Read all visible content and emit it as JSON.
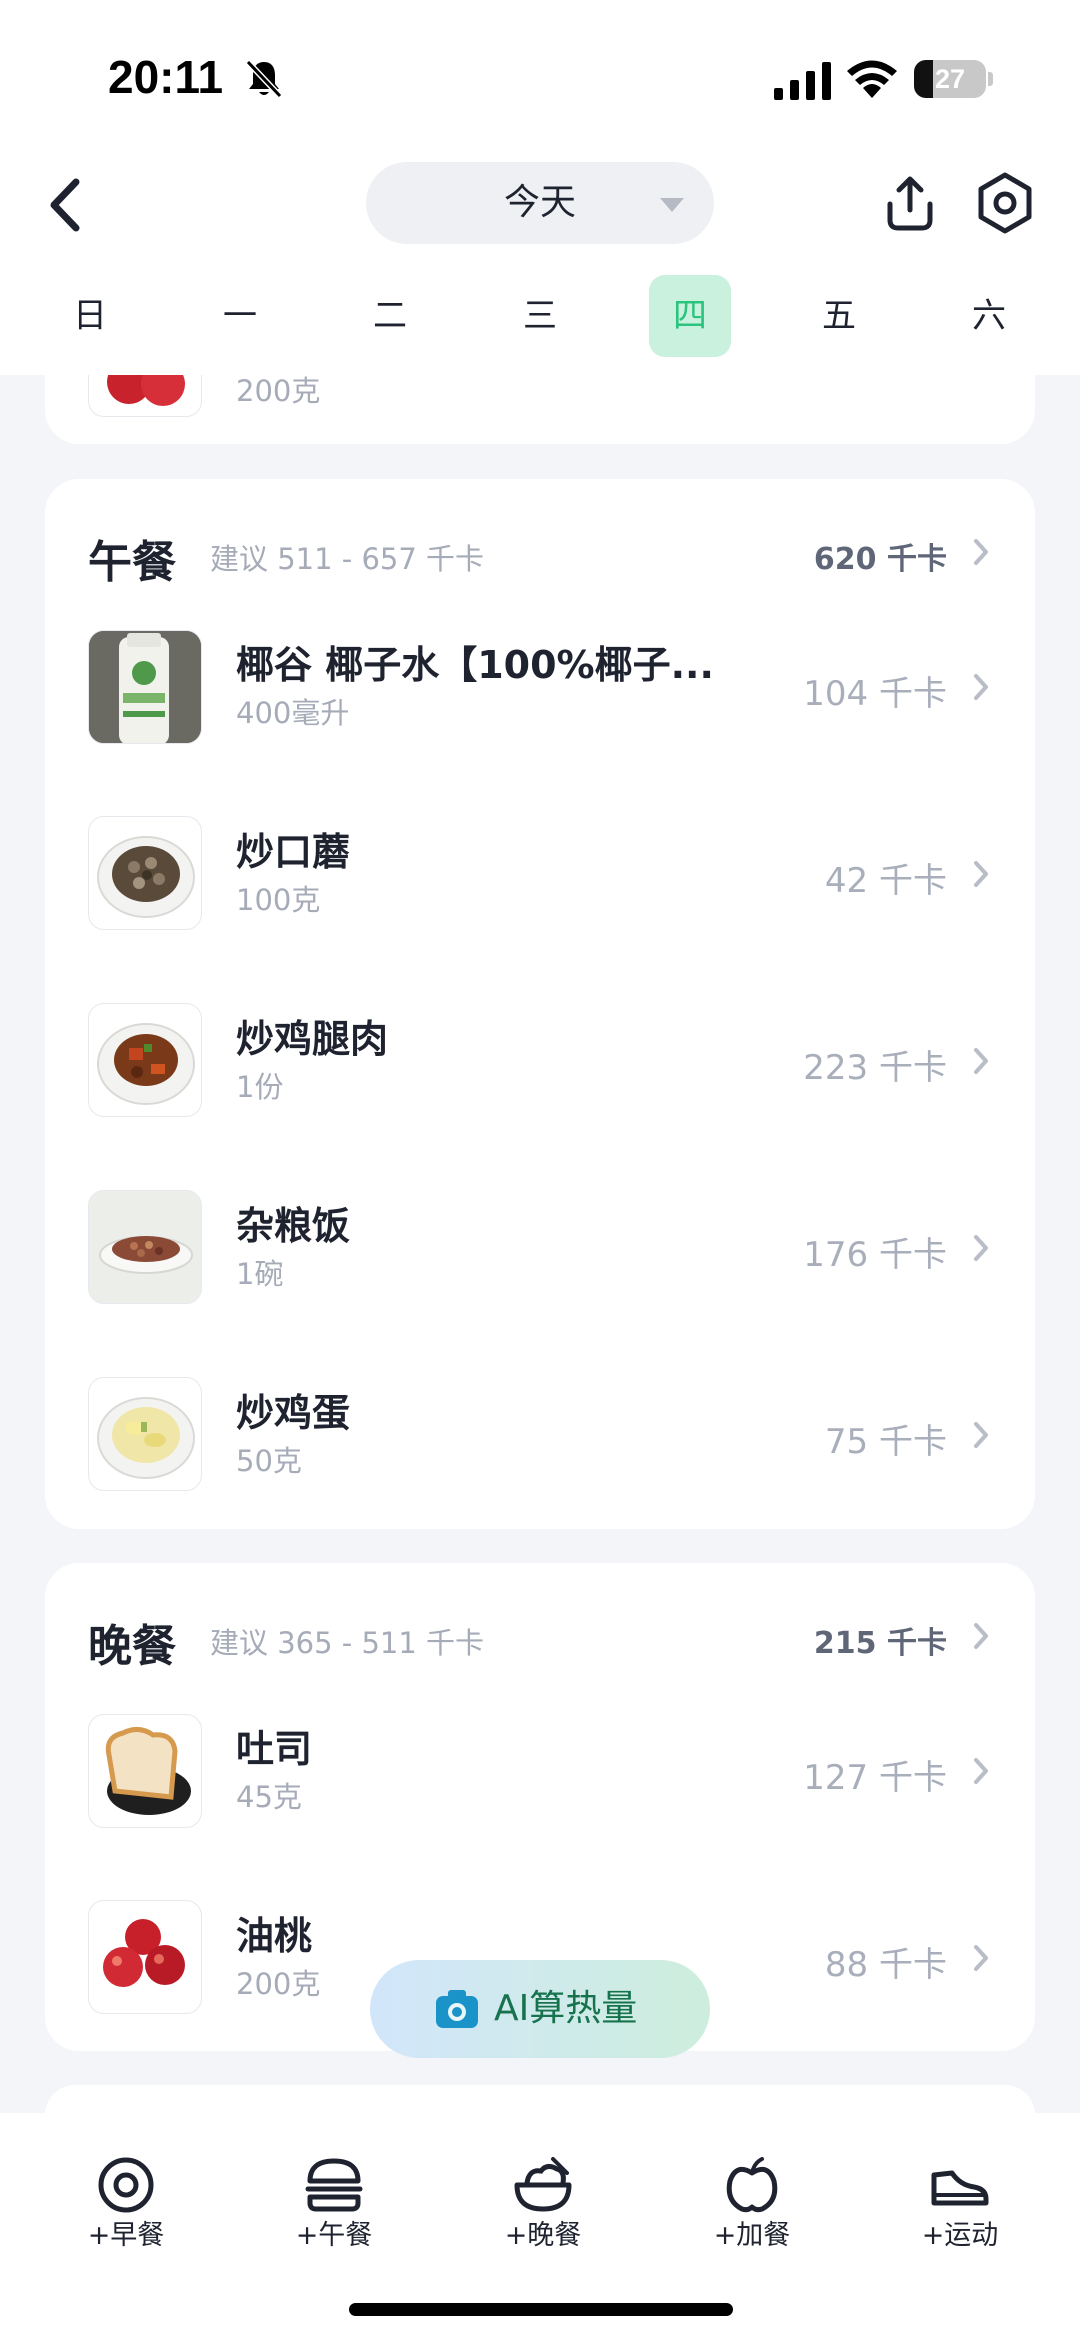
{
  "status": {
    "time": "20:11",
    "battery": "27",
    "battery_level": 0.27
  },
  "header": {
    "date_label": "今天",
    "weekdays": [
      "日",
      "一",
      "二",
      "三",
      "四",
      "五",
      "六"
    ],
    "selected_weekday": "四"
  },
  "breakfast_partial": {
    "last_item_amount": "200克"
  },
  "lunch": {
    "title": "午餐",
    "suggestion": "建议 511 - 657 千卡",
    "total": "620 千卡",
    "items": [
      {
        "name": "椰谷 椰子水【100%椰子...",
        "amount": "400毫升",
        "kcal": "104 千卡",
        "image": "coconut-water-bottle"
      },
      {
        "name": "炒口蘑",
        "amount": "100克",
        "kcal": "42 千卡",
        "image": "fried-mushrooms"
      },
      {
        "name": "炒鸡腿肉",
        "amount": "1份",
        "kcal": "223 千卡",
        "image": "fried-chicken-leg"
      },
      {
        "name": "杂粮饭",
        "amount": "1碗",
        "kcal": "176 千卡",
        "image": "mixed-grain-rice"
      },
      {
        "name": "炒鸡蛋",
        "amount": "50克",
        "kcal": "75 千卡",
        "image": "scrambled-eggs"
      }
    ]
  },
  "dinner": {
    "title": "晚餐",
    "suggestion": "建议 365 - 511 千卡",
    "total": "215 千卡",
    "items": [
      {
        "name": "吐司",
        "amount": "45克",
        "kcal": "127 千卡",
        "image": "toast"
      },
      {
        "name": "油桃",
        "amount": "200克",
        "kcal": "88 千卡",
        "image": "nectarines"
      }
    ]
  },
  "ai_button": {
    "label": "AI算热量",
    "icon": "camera-icon"
  },
  "bottom_tabs": [
    {
      "label": "+早餐",
      "icon": "egg-icon"
    },
    {
      "label": "+午餐",
      "icon": "burger-icon"
    },
    {
      "label": "+晚餐",
      "icon": "bowl-icon"
    },
    {
      "label": "+加餐",
      "icon": "apple-icon"
    },
    {
      "label": "+运动",
      "icon": "sneaker-icon"
    }
  ],
  "colors": {
    "accent_green": "#2bc47e",
    "active_day_bg": "#c9f1de",
    "background": "#f4f5f9"
  }
}
